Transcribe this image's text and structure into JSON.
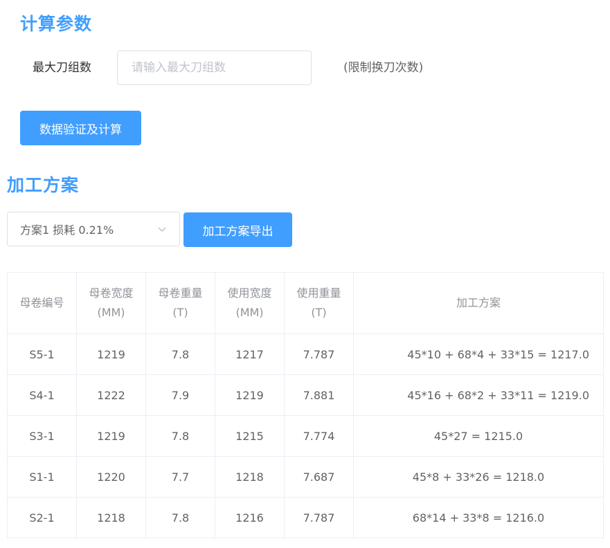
{
  "calc_section": {
    "title": "计算参数",
    "max_knife_label": "最大刀组数",
    "max_knife_input": {
      "value": "",
      "placeholder": "请输入最大刀组数"
    },
    "hint": "(限制换刀次数)",
    "validate_button": "数据验证及计算"
  },
  "plan_section": {
    "title": "加工方案",
    "select_value": "方案1  损耗 0.21%",
    "export_button": "加工方案导出",
    "table": {
      "headers": [
        {
          "line1": "母卷编号",
          "line2": ""
        },
        {
          "line1": "母卷宽度",
          "line2": "(MM)"
        },
        {
          "line1": "母卷重量",
          "line2": "(T)"
        },
        {
          "line1": "使用宽度",
          "line2": "(MM)"
        },
        {
          "line1": "使用重量",
          "line2": "(T)"
        },
        {
          "line1": "加工方案",
          "line2": ""
        }
      ],
      "rows": [
        [
          "S5-1",
          "1219",
          "7.8",
          "1217",
          "7.787",
          "45*10 + 68*4 + 33*15 = 1217.0"
        ],
        [
          "S4-1",
          "1222",
          "7.9",
          "1219",
          "7.881",
          "45*16 + 68*2 + 33*11 = 1219.0"
        ],
        [
          "S3-1",
          "1219",
          "7.8",
          "1215",
          "7.774",
          "45*27 = 1215.0"
        ],
        [
          "S1-1",
          "1220",
          "7.7",
          "1218",
          "7.687",
          "45*8 + 33*26 = 1218.0"
        ],
        [
          "S2-1",
          "1218",
          "7.8",
          "1216",
          "7.787",
          "68*14 + 33*8 = 1216.0"
        ]
      ]
    }
  },
  "colors": {
    "accent": "#409eff",
    "border": "#ebeef5",
    "header_text": "#909399",
    "body_text": "#606266"
  },
  "icons": {
    "select_arrow": "chevron-down-icon"
  }
}
